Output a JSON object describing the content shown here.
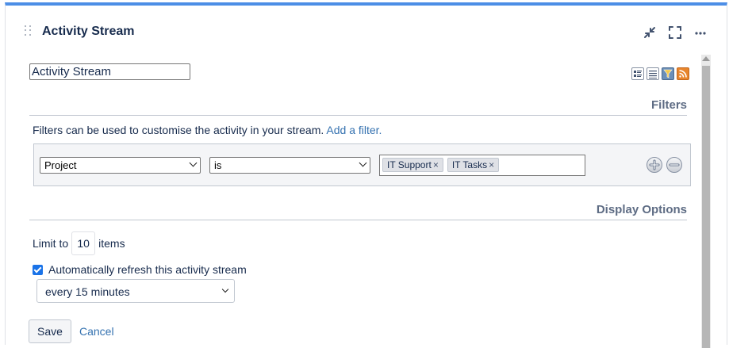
{
  "gadget": {
    "title": "Activity Stream",
    "header_icons": [
      "minimize-icon",
      "fullscreen-icon",
      "more-icon"
    ]
  },
  "title_field": {
    "value": "Activity Stream"
  },
  "view_icons": [
    "full-view-icon",
    "list-view-icon",
    "filter-view-icon",
    "rss-icon"
  ],
  "filters": {
    "heading": "Filters",
    "description": "Filters can be used to customise the activity in your stream.",
    "add_filter_link": "Add a filter.",
    "row": {
      "field": "Project",
      "operator": "is",
      "values": [
        "IT Support",
        "IT Tasks"
      ],
      "remove_glyph": "×"
    }
  },
  "display_options": {
    "heading": "Display Options",
    "limit_prefix": "Limit to",
    "limit_value": "10",
    "limit_suffix": "items",
    "auto_refresh_label": "Automatically refresh this activity stream",
    "auto_refresh_checked": true,
    "refresh_interval": "every 15 minutes"
  },
  "actions": {
    "save_label": "Save",
    "cancel_label": "Cancel"
  },
  "colors": {
    "accent_top_border": "#4c8ee6",
    "link": "#3572b0",
    "checkbox": "#1a73e8"
  }
}
